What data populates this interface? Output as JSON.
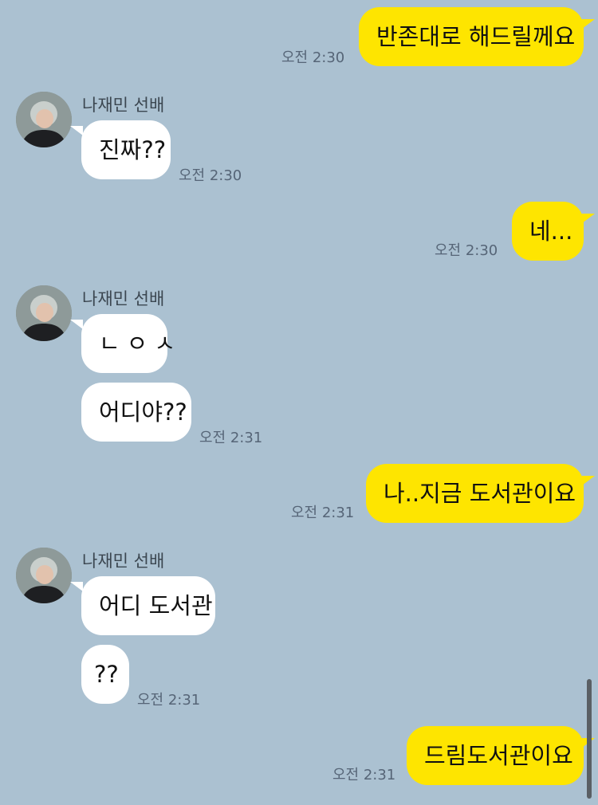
{
  "contact": {
    "name": "나재민 선배",
    "avatar": "profile-photo"
  },
  "messages": [
    {
      "side": "out",
      "text": "반존대로 해드릴께요",
      "time": "오전 2:30"
    },
    {
      "side": "in",
      "text": "진짜??",
      "time": "오전 2:30"
    },
    {
      "side": "out",
      "text": "네...",
      "time": "오전 2:30"
    },
    {
      "side": "in",
      "text": "ㄴㅇㅅ",
      "time": ""
    },
    {
      "side": "in",
      "text": "어디야??",
      "time": "오전 2:31"
    },
    {
      "side": "out",
      "text": "나..지금 도서관이요",
      "time": "오전 2:31"
    },
    {
      "side": "in",
      "text": "어디 도서관",
      "time": ""
    },
    {
      "side": "in",
      "text": "??",
      "time": "오전 2:31"
    },
    {
      "side": "out",
      "text": "드림도서관이요",
      "time": "오전 2:31"
    }
  ],
  "colors": {
    "background": "#abc1d1",
    "outgoing_bubble": "#fee500",
    "incoming_bubble": "#ffffff"
  }
}
